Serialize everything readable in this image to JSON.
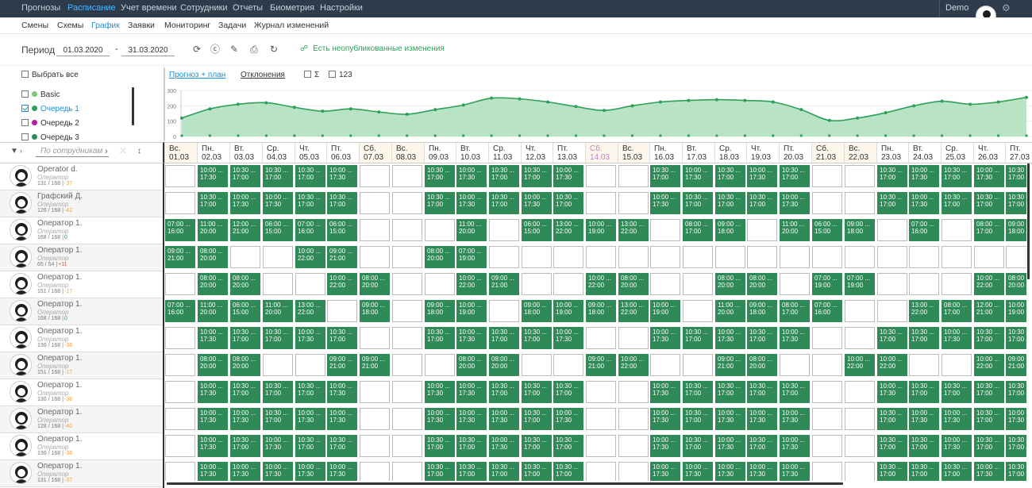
{
  "topnav": {
    "items": [
      {
        "label": "Прогнозы",
        "active": false
      },
      {
        "label": "Расписание",
        "active": true
      },
      {
        "label": "Учет времени",
        "active": false
      },
      {
        "label": "Сотрудники",
        "active": false
      },
      {
        "label": "Отчеты",
        "active": false
      },
      {
        "label": "Биометрия",
        "active": false
      },
      {
        "label": "Настройки",
        "active": false
      }
    ],
    "user": "Demo",
    "settings_icon": "settings-icon"
  },
  "subnav": {
    "items": [
      {
        "label": "Смены",
        "active": false
      },
      {
        "label": "Схемы",
        "active": false
      },
      {
        "label": "График",
        "active": true
      },
      {
        "label": "Заявки",
        "active": false
      },
      {
        "label": "Мониторинг",
        "active": false
      },
      {
        "label": "Задачи",
        "active": false
      },
      {
        "label": "Журнал изменений",
        "active": false
      }
    ]
  },
  "period": {
    "label": "Период",
    "from": "01.03.2020",
    "to": "31.03.2020",
    "separator": "-",
    "unpublished": "Есть неопубликованные изменения",
    "tools": [
      "refresh-icon",
      "currency-icon",
      "edit-icon",
      "print-icon",
      "redo-icon"
    ]
  },
  "queues": {
    "select_all": "Выбрать все",
    "items": [
      {
        "label": "Basic",
        "checked": false,
        "color": "#7cc576"
      },
      {
        "label": "Очередь 1",
        "checked": true,
        "color": "#2ea05a"
      },
      {
        "label": "Очередь 2",
        "checked": false,
        "color": "#b51fa3"
      },
      {
        "label": "Очередь 3",
        "checked": false,
        "color": "#2f8a57"
      }
    ]
  },
  "chart_tabs": {
    "forecast_plan": "Прогноз + план",
    "deviations": "Отклонения",
    "sum": "Σ",
    "num": "123"
  },
  "chart_data": {
    "type": "area",
    "y_ticks": [
      "300",
      "200",
      "100",
      "0"
    ],
    "ylim": [
      0,
      300
    ],
    "plan_values": [
      120,
      180,
      210,
      220,
      190,
      165,
      180,
      160,
      145,
      175,
      205,
      250,
      245,
      225,
      195,
      170,
      200,
      225,
      235,
      240,
      235,
      225,
      175,
      105,
      120,
      155,
      200,
      230,
      210,
      225,
      255
    ]
  },
  "filter": {
    "placeholder": "По сотрудникам",
    "icons": [
      "filter-icon",
      "sort-icon"
    ]
  },
  "days": [
    {
      "wd": "Вс.",
      "date": "01.03",
      "weekend": true,
      "holiday": false
    },
    {
      "wd": "Пн.",
      "date": "02.03",
      "weekend": false,
      "holiday": false
    },
    {
      "wd": "Вт.",
      "date": "03.03",
      "weekend": false,
      "holiday": false
    },
    {
      "wd": "Ср.",
      "date": "04.03",
      "weekend": false,
      "holiday": false
    },
    {
      "wd": "Чт.",
      "date": "05.03",
      "weekend": false,
      "holiday": false
    },
    {
      "wd": "Пт.",
      "date": "06.03",
      "weekend": false,
      "holiday": false
    },
    {
      "wd": "Сб.",
      "date": "07.03",
      "weekend": true,
      "holiday": false
    },
    {
      "wd": "Вс.",
      "date": "08.03",
      "weekend": true,
      "holiday": false
    },
    {
      "wd": "Пн.",
      "date": "09.03",
      "weekend": false,
      "holiday": false
    },
    {
      "wd": "Вт.",
      "date": "10.03",
      "weekend": false,
      "holiday": false
    },
    {
      "wd": "Ср.",
      "date": "11.03",
      "weekend": false,
      "holiday": false
    },
    {
      "wd": "Чт.",
      "date": "12.03",
      "weekend": false,
      "holiday": false
    },
    {
      "wd": "Пт.",
      "date": "13.03",
      "weekend": false,
      "holiday": false
    },
    {
      "wd": "Сб.",
      "date": "14.03",
      "weekend": true,
      "holiday": true
    },
    {
      "wd": "Вс.",
      "date": "15.03",
      "weekend": true,
      "holiday": false
    },
    {
      "wd": "Пн.",
      "date": "16.03",
      "weekend": false,
      "holiday": false
    },
    {
      "wd": "Вт.",
      "date": "17.03",
      "weekend": false,
      "holiday": false
    },
    {
      "wd": "Ср.",
      "date": "18.03",
      "weekend": false,
      "holiday": false
    },
    {
      "wd": "Чт.",
      "date": "19.03",
      "weekend": false,
      "holiday": false
    },
    {
      "wd": "Пт.",
      "date": "20.03",
      "weekend": false,
      "holiday": false
    },
    {
      "wd": "Сб.",
      "date": "21.03",
      "weekend": true,
      "holiday": false
    },
    {
      "wd": "Вс.",
      "date": "22.03",
      "weekend": true,
      "holiday": false
    },
    {
      "wd": "Пн.",
      "date": "23.03",
      "weekend": false,
      "holiday": false
    },
    {
      "wd": "Вт.",
      "date": "24.03",
      "weekend": false,
      "holiday": false
    },
    {
      "wd": "Ср.",
      "date": "25.03",
      "weekend": false,
      "holiday": false
    },
    {
      "wd": "Чт.",
      "date": "26.03",
      "weekend": false,
      "holiday": false
    },
    {
      "wd": "Пт.",
      "date": "27.03",
      "weekend": false,
      "holiday": false
    }
  ],
  "employees": [
    {
      "name": "Operator d.",
      "role": "Оператор",
      "hours": "131 / 168 |",
      "delta": "-37",
      "shifts": [
        "",
        "10:00 ...|17:30",
        "10:30 ...|17:00",
        "10:30 ...|17:00",
        "10:30 ...|17:00",
        "10:00 ...|17:30",
        "",
        "",
        "10:30 ...|17:00",
        "10:00 ...|17:30",
        "10:30 ...|17:00",
        "10:30 ...|17:00",
        "10:00 ...|17:30",
        "",
        "",
        "10:30 ...|17:00",
        "10:00 ...|17:30",
        "10:30 ...|17:00",
        "10:00 ...|17:30",
        "10:30 ...|17:00",
        "",
        "",
        "10:30 ...|17:00",
        "10:00 ...|17:30",
        "10:30 ...|17:00",
        "10:00 ...|17:30",
        "10:30 ...|17:00"
      ]
    },
    {
      "name": "Графский Д.",
      "role": "Оператор",
      "hours": "126 / 168 |",
      "delta": "-42",
      "shifts": [
        "",
        "10:30 ...|17:00",
        "10:00 ...|17:30",
        "10:00 ...|17:30",
        "10:30 ...|17:00",
        "10:30 ...|17:00",
        "",
        "",
        "10:30 ...|17:00",
        "10:00 ...|17:30",
        "10:30 ...|17:00",
        "10:00 ...|17:30",
        "10:30 ...|17:00",
        "",
        "",
        "10:00 ...|17:30",
        "10:30 ...|17:00",
        "10:30 ...|17:00",
        "10:30 ...|17:00",
        "10:00 ...|17:30",
        "",
        "",
        "10:30 ...|17:00",
        "10:00 ...|17:30",
        "10:30 ...|17:00",
        "10:30 ...|17:00",
        "10:30 ...|17:00"
      ]
    },
    {
      "name": "Оператор 1.",
      "role": "Оператор",
      "hours": "168 / 168 |",
      "delta": "0",
      "shifts": [
        "07:00 ...|16:00",
        "11:00 ...|20:00",
        "12:00 ...|21:00",
        "06:00 ...|15:00",
        "07:00 ...|16:00",
        "06:00 ...|15:00",
        "",
        "",
        "",
        "11:00 ...|20:00",
        "",
        "06:00 ...|15:00",
        "13:00 ...|22:00",
        "10:00 ...|19:00",
        "13:00 ...|22:00",
        "",
        "08:00 ...|17:00",
        "09:00 ...|18:00",
        "",
        "11:00 ...|20:00",
        "06:00 ...|15:00",
        "09:00 ...|18:00",
        "",
        "07:00 ...|16:00",
        "",
        "08:00 ...|17:00",
        "09:00 ...|18:00"
      ]
    },
    {
      "name": "Оператор 1.",
      "role": "Оператор",
      "hours": "65 / 54 |",
      "delta": "+11",
      "shifts": [
        "09:00 ...|21:00",
        "08:00 ...|20:00",
        "",
        "",
        "10:00 ...|22:00",
        "09:00 ...|21:00",
        "",
        "",
        "08:00 ...|20:00",
        "07:00 ...|19:00",
        "",
        "",
        "",
        "",
        "",
        "",
        "",
        "",
        "",
        "",
        "",
        "",
        "",
        "",
        "",
        "",
        ""
      ]
    },
    {
      "name": "Оператор 1.",
      "role": "Оператор",
      "hours": "151 / 168 |",
      "delta": "-17",
      "shifts": [
        "",
        "08:00 ...|20:00",
        "08:00 ...|20:00",
        "",
        "",
        "10:00 ...|22:00",
        "08:00 ...|20:00",
        "",
        "",
        "10:00 ...|22:00",
        "09:00 ...|21:00",
        "",
        "",
        "10:00 ...|22:00",
        "08:00 ...|20:00",
        "",
        "",
        "08:00 ...|20:00",
        "08:00 ...|20:00",
        "",
        "07:00 ...|19:00",
        "07:00 ...|19:00",
        "",
        "",
        "",
        "10:00 ...|22:00",
        "08:00 ...|20:00"
      ]
    },
    {
      "name": "Оператор 1.",
      "role": "Оператор",
      "hours": "168 / 168 |",
      "delta": "0",
      "shifts": [
        "07:00 ...|16:00",
        "11:00 ...|20:00",
        "06:00 ...|15:00",
        "11:00 ...|20:00",
        "13:00 ...|22:00",
        "",
        "09:00 ...|18:00",
        "",
        "09:00 ...|18:00",
        "10:00 ...|19:00",
        "",
        "09:00 ...|18:00",
        "10:00 ...|19:00",
        "09:00 ...|18:00",
        "13:00 ...|22:00",
        "10:00 ...|19:00",
        "",
        "11:00 ...|20:00",
        "09:00 ...|18:00",
        "08:00 ...|17:00",
        "07:00 ...|16:00",
        "",
        "",
        "13:00 ...|22:00",
        "08:00 ...|17:00",
        "12:00 ...|21:00",
        "10:00 ...|19:00"
      ]
    },
    {
      "name": "Оператор 1.",
      "role": "Оператор",
      "hours": "130 / 168 |",
      "delta": "-38",
      "shifts": [
        "",
        "10:00 ...|17:30",
        "10:30 ...|17:00",
        "10:30 ...|17:00",
        "10:00 ...|17:30",
        "10:30 ...|17:00",
        "",
        "",
        "10:30 ...|17:00",
        "10:00 ...|17:30",
        "10:30 ...|17:00",
        "10:30 ...|17:00",
        "10:00 ...|17:30",
        "",
        "",
        "10:00 ...|17:30",
        "10:30 ...|17:00",
        "10:00 ...|17:30",
        "10:30 ...|17:00",
        "10:00 ...|17:30",
        "",
        "",
        "10:30 ...|17:00",
        "10:30 ...|17:00",
        "10:00 ...|17:30",
        "10:30 ...|17:00",
        "10:30 ...|17:00"
      ]
    },
    {
      "name": "Оператор 1.",
      "role": "Оператор",
      "hours": "151 / 168 |",
      "delta": "-17",
      "shifts": [
        "",
        "08:00 ...|20:00",
        "08:00 ...|20:00",
        "",
        "",
        "09:00 ...|21:00",
        "09:00 ...|21:00",
        "",
        "",
        "08:00 ...|20:00",
        "08:00 ...|20:00",
        "",
        "",
        "09:00 ...|21:00",
        "10:00 ...|22:00",
        "",
        "",
        "09:00 ...|21:00",
        "08:00 ...|20:00",
        "",
        "",
        "10:00 ...|22:00",
        "10:00 ...|22:00",
        "",
        "",
        "10:00 ...|22:00",
        "09:00 ...|21:00"
      ]
    },
    {
      "name": "Оператор 1.",
      "role": "Оператор",
      "hours": "130 / 168 |",
      "delta": "-38",
      "shifts": [
        "",
        "10:00 ...|17:30",
        "10:30 ...|17:00",
        "10:30 ...|17:00",
        "10:30 ...|17:00",
        "10:00 ...|17:30",
        "",
        "",
        "10:00 ...|17:30",
        "10:00 ...|17:30",
        "10:30 ...|17:00",
        "10:30 ...|17:00",
        "10:30 ...|17:00",
        "",
        "",
        "10:00 ...|17:30",
        "10:30 ...|17:00",
        "10:30 ...|17:00",
        "10:30 ...|17:00",
        "10:30 ...|17:00",
        "",
        "",
        "10:00 ...|17:30",
        "10:30 ...|17:00",
        "10:30 ...|17:00",
        "10:30 ...|17:00",
        "10:30 ...|17:00"
      ]
    },
    {
      "name": "Оператор 1.",
      "role": "Оператор",
      "hours": "128 / 168 |",
      "delta": "-40",
      "shifts": [
        "",
        "10:00 ...|17:30",
        "10:00 ...|17:30",
        "10:30 ...|17:00",
        "10:00 ...|17:30",
        "10:00 ...|17:30",
        "",
        "",
        "10:00 ...|17:30",
        "10:00 ...|17:30",
        "10:00 ...|17:30",
        "10:30 ...|17:00",
        "10:00 ...|17:30",
        "",
        "",
        "10:00 ...|17:30",
        "10:30 ...|17:00",
        "10:00 ...|17:30",
        "10:00 ...|17:30",
        "10:00 ...|17:30",
        "",
        "",
        "10:30 ...|17:00",
        "10:00 ...|17:30",
        "10:00 ...|17:30",
        "10:30 ...|17:00",
        "10:00 ...|17:30"
      ]
    },
    {
      "name": "Оператор 1.",
      "role": "Оператор",
      "hours": "130 / 168 |",
      "delta": "-38",
      "shifts": [
        "",
        "10:00 ...|17:30",
        "10:30 ...|17:00",
        "10:00 ...|17:30",
        "10:30 ...|17:00",
        "10:30 ...|17:00",
        "",
        "",
        "10:30 ...|17:00",
        "10:30 ...|17:00",
        "10:00 ...|17:30",
        "10:30 ...|17:00",
        "10:30 ...|17:00",
        "",
        "",
        "10:00 ...|17:30",
        "10:30 ...|17:00",
        "10:00 ...|17:30",
        "10:30 ...|17:00",
        "10:00 ...|17:30",
        "",
        "",
        "10:30 ...|17:00",
        "10:30 ...|17:00",
        "10:00 ...|17:30",
        "10:30 ...|17:00",
        "10:30 ...|17:00"
      ]
    },
    {
      "name": "Оператор 1.",
      "role": "Оператор",
      "hours": "131 / 168 |",
      "delta": "-37",
      "shifts": [
        "",
        "10:00 ...|17:30",
        "10:00 ...|17:30",
        "10:00 ...|17:30",
        "10:00 ...|17:30",
        "10:00 ...|17:30",
        "",
        "",
        "10:30 ...|17:00",
        "10:30 ...|17:00",
        "10:30 ...|17:00",
        "10:30 ...|17:00",
        "10:30 ...|17:00",
        "",
        "",
        "10:00 ...|17:30",
        "10:00 ...|17:30",
        "10:00 ...|17:30",
        "10:00 ...|17:30",
        "10:00 ...|17:30",
        "",
        "",
        "10:30 ...|17:00",
        "10:30 ...|17:00",
        "10:30 ...|17:00",
        "10:00 ...|17:30",
        "10:30 ...|17:00"
      ]
    }
  ]
}
